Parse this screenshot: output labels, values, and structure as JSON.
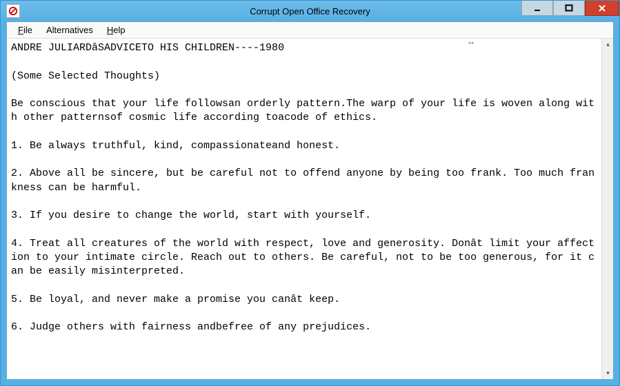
{
  "window": {
    "title": "Corrupt Open Office Recovery"
  },
  "menu": {
    "file": "File",
    "alternatives": "Alternatives",
    "help": "Help"
  },
  "document": {
    "text": "ANDRE JULIARDâSADVICETO HIS CHILDREN----1980\n\n(Some Selected Thoughts)\n\nBe conscious that your life followsan orderly pattern.The warp of your life is woven along with other patternsof cosmic life according toacode of ethics.\n\n1. Be always truthful, kind, compassionateand honest.\n\n2. Above all be sincere, but be careful not to offend anyone by being too frank. Too much frankness can be harmful.\n\n3. If you desire to change the world, start with yourself.\n\n4. Treat all creatures of the world with respect, love and generosity. Donât limit your affection to your intimate circle. Reach out to others. Be careful, not to be too generous, for it can be easily misinterpreted.\n\n5. Be loyal, and never make a promise you canât keep.\n\n6. Judge others with fairness andbefree of any prejudices."
  }
}
